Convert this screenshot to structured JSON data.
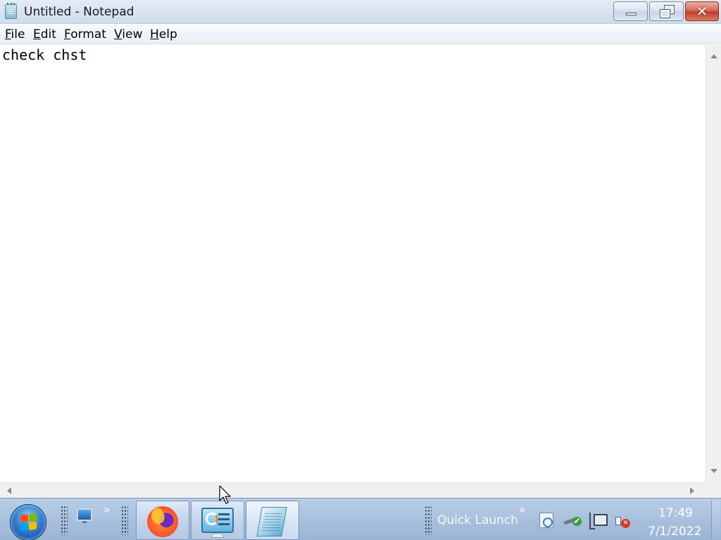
{
  "window": {
    "title": "Untitled - Notepad",
    "icon": "notepad-icon",
    "controls": {
      "minimize": "minimize-icon",
      "restore": "restore-icon",
      "close": "close-icon",
      "close_color": "#c0402c"
    }
  },
  "menu": {
    "items": [
      {
        "underline": "F",
        "rest": "ile"
      },
      {
        "underline": "E",
        "rest": "dit"
      },
      {
        "underline": "F",
        "rest": "ormat"
      },
      {
        "underline": "V",
        "rest": "iew"
      },
      {
        "underline": "H",
        "rest": "elp"
      }
    ]
  },
  "editor": {
    "text": "check chst"
  },
  "taskbar": {
    "start_icon": "windows-start-icon",
    "quick_launch_label": "Quick Launch",
    "chevron": "»",
    "tasks": [
      {
        "name": "Firefox",
        "icon": "firefox-icon"
      },
      {
        "name": "Control Panel",
        "icon": "control-panel-icon"
      },
      {
        "name": "Notepad",
        "icon": "notepad-icon",
        "active": true
      }
    ],
    "tray_icons": [
      "document-icon",
      "usb-safely-remove-icon",
      "network-icon",
      "volume-muted-icon"
    ],
    "clock": {
      "time": "17:49",
      "date": "7/1/2022"
    },
    "color": "#a9c1de"
  }
}
